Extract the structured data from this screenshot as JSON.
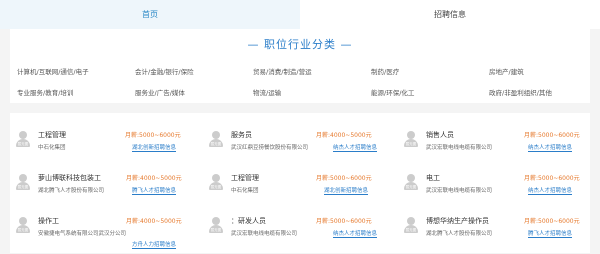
{
  "tabs": [
    {
      "label": "首页",
      "active": true
    },
    {
      "label": "招聘信息",
      "active": false
    }
  ],
  "section_title": "— 职位行业分类 —",
  "categories": [
    [
      "计算机/互联网/通信/电子",
      "会计/金融/银行/保险",
      "贸易/消费/制造/营运",
      "制药/医疗",
      "房地产/建筑"
    ],
    [
      "专业服务/教育/培训",
      "服务业/广告/媒体",
      "物流/运输",
      "能源/环保/化工",
      "政府/非盈利组织/其他"
    ]
  ],
  "avatar_text": "暂无图",
  "jobs": [
    {
      "title": "工程管理",
      "salary": "月薪:5000~6000元",
      "company": "中石化集团",
      "source": "湖北创新招聘信息"
    },
    {
      "title": "服务员",
      "salary": "月薪:4000~5000元",
      "company": "武汉红鼎豆捞餐饮股份有限公司",
      "source": "纳杰人才招聘信息"
    },
    {
      "title": "销售人员",
      "salary": "月薪:5000~6000元",
      "company": "武汉宏联电线电缆有限公司",
      "source": "纳杰人才招聘信息"
    },
    {
      "title": "萝山博联科技包装工",
      "salary": "月薪:4000~5000元",
      "company": "湖北腾飞人才股份有限公司",
      "source": "腾飞人才招聘信息"
    },
    {
      "title": "工程管理",
      "salary": "月薪:5000~6000元",
      "company": "中石化集团",
      "source": "湖北创新招聘信息"
    },
    {
      "title": "电工",
      "salary": "月薪:5000~6000元",
      "company": "武汉宏联电线电缆有限公司",
      "source": "纳杰人才招聘信息"
    },
    {
      "title": "操作工",
      "salary": "月薪:4000~5000元",
      "company": "安徽捷电气系统有限公司武汉分公司",
      "source": "方舟人力招聘信息"
    },
    {
      "title": "：研发人员",
      "salary": "月薪:5000~6000元",
      "company": "武汉宏联电线电缆有限公司",
      "source": "纳杰人才招聘信息"
    },
    {
      "title": "博想华纳生产操作员",
      "salary": "月薪:5000~6000元",
      "company": "湖北腾飞人才股份有限公司",
      "source": "腾飞人才招聘信息"
    }
  ]
}
